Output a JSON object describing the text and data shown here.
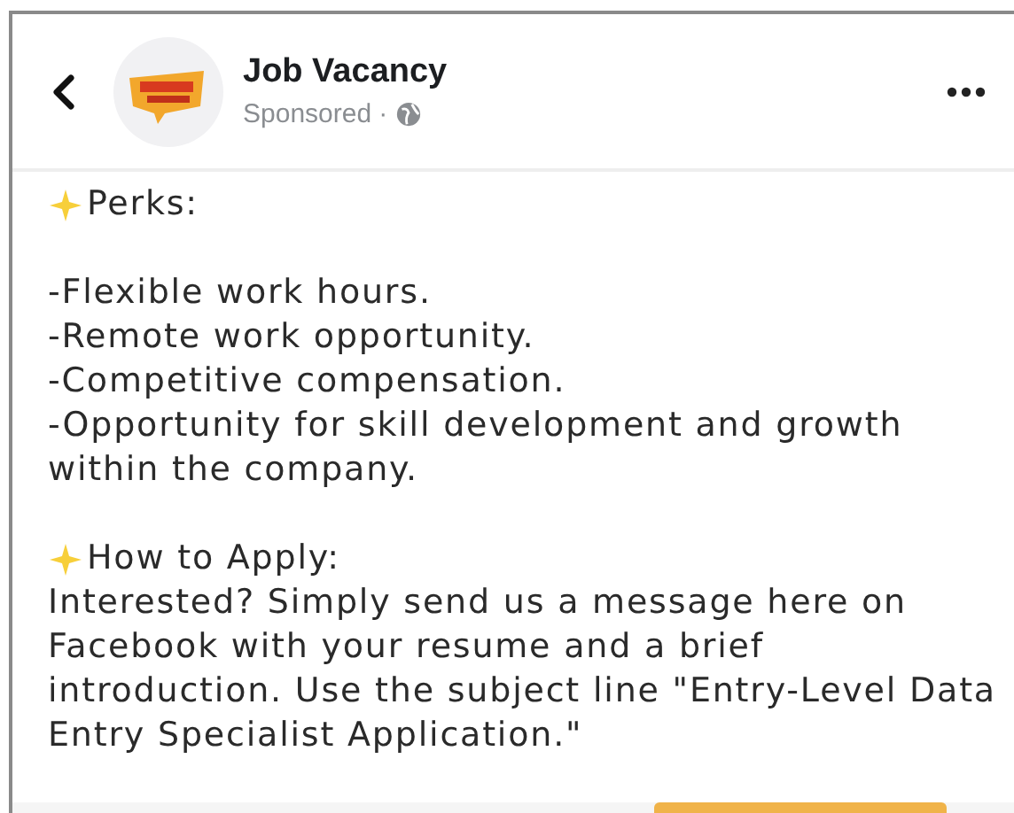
{
  "post": {
    "page_name": "Job Vacancy",
    "sponsored_label": "Sponsored",
    "separator": "·"
  },
  "sections": [
    {
      "heading": "Perks:",
      "kind": "list",
      "items": [
        "-Flexible work hours.",
        "-Remote work opportunity.",
        "-Competitive compensation.",
        "-Opportunity for skill development and growth within the company."
      ]
    },
    {
      "heading": "How to Apply:",
      "kind": "paragraph",
      "text": "Interested? Simply send us a message here on Facebook with your resume and a brief introduction. Use the subject line \"Entry-Level Data Entry Specialist Application.\""
    }
  ]
}
